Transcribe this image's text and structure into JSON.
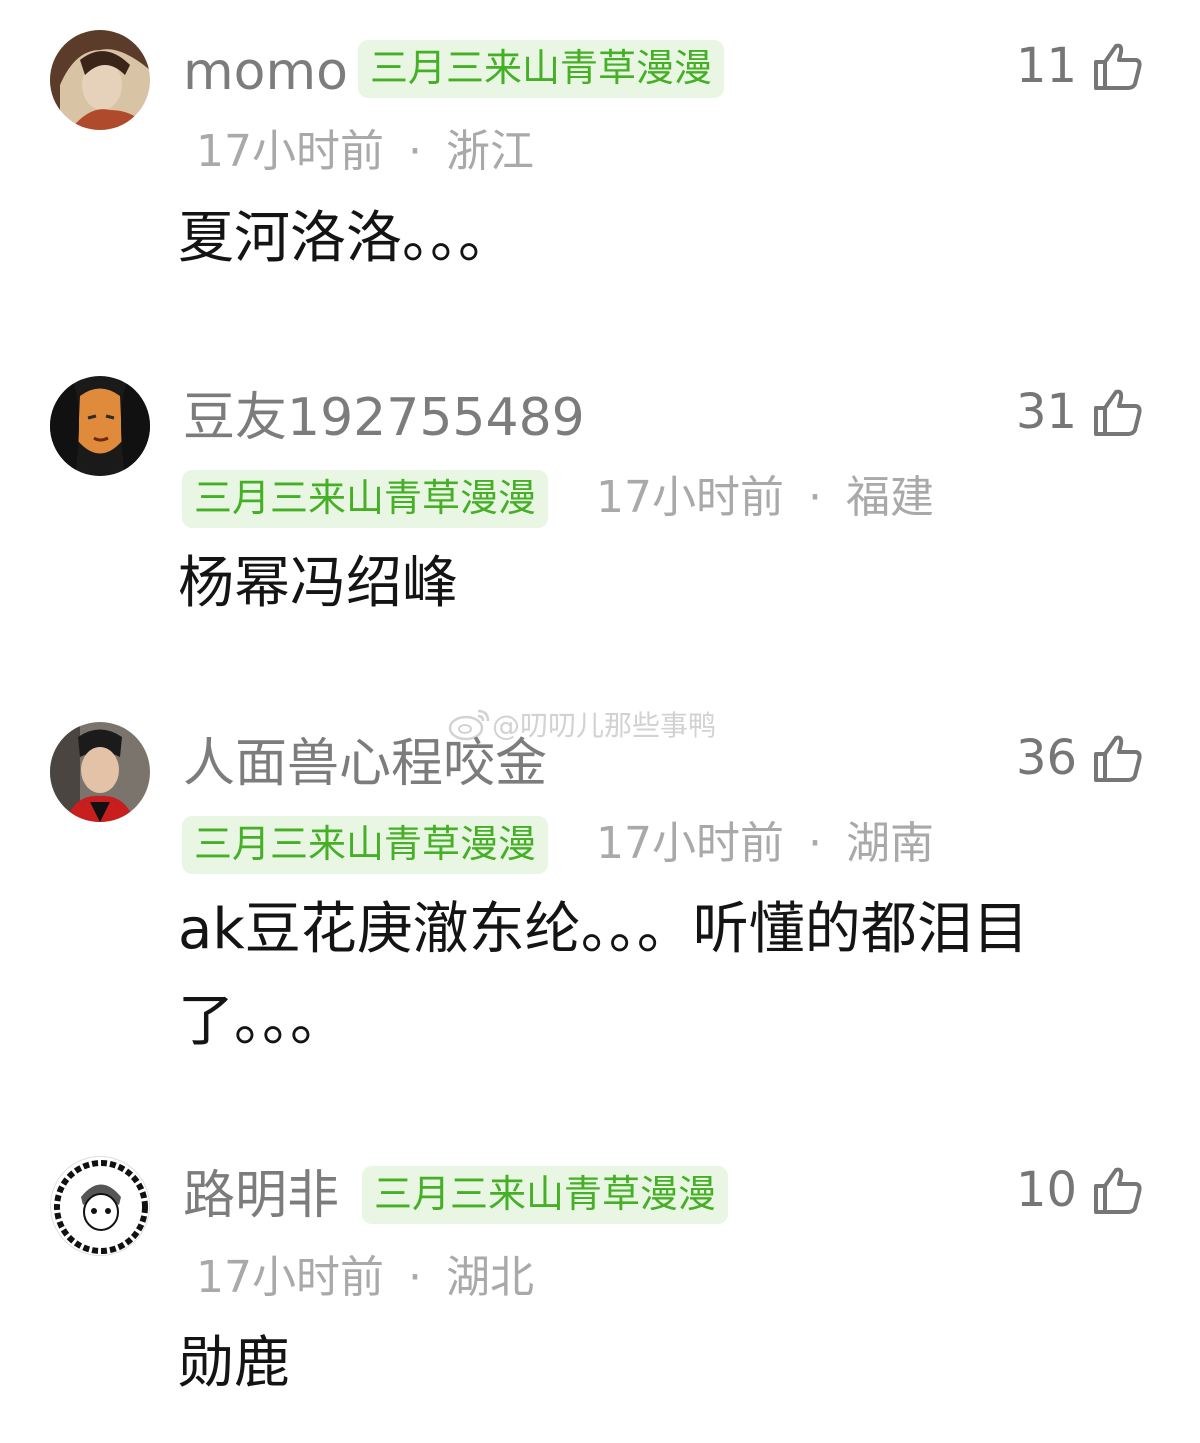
{
  "comments": [
    {
      "username": "momo",
      "badge": "三月三来山青草漫漫",
      "time": "17小时前",
      "location": "浙江",
      "text": "夏河洛洛。。。",
      "likes": "11",
      "avatar_colors": [
        "#5b3b2a",
        "#d8c3a5",
        "#b04a2d"
      ]
    },
    {
      "username": "豆友192755489",
      "badge": "三月三来山青草漫漫",
      "time": "17小时前",
      "location": "福建",
      "text": "杨幂冯绍峰",
      "likes": "31",
      "avatar_colors": [
        "#1a1a1a",
        "#e08a3c",
        "#2c2c2c"
      ]
    },
    {
      "username": "人面兽心程咬金",
      "badge": "三月三来山青草漫漫",
      "time": "17小时前",
      "location": "湖南",
      "text": "ak豆花庚澈东纶。。。听懂的都泪目了。。。",
      "likes": "36",
      "avatar_colors": [
        "#4a4540",
        "#e3c2a8",
        "#c81e1e"
      ]
    },
    {
      "username": "路明非",
      "badge": "三月三来山青草漫漫",
      "time": "17小时前",
      "location": "湖北",
      "text": "勋鹿",
      "likes": "10",
      "avatar_colors": [
        "#ffffff",
        "#111111",
        "#555555"
      ]
    }
  ],
  "separator": "·",
  "watermark": "@叨叨儿那些事鸭",
  "colors": {
    "badge_bg": "#eaf6e4",
    "badge_text": "#45b026",
    "meta": "#a9a9a9",
    "name": "#7c7c7c"
  },
  "icons": {
    "like": "thumbs-up-icon",
    "watermark": "weibo-icon"
  }
}
